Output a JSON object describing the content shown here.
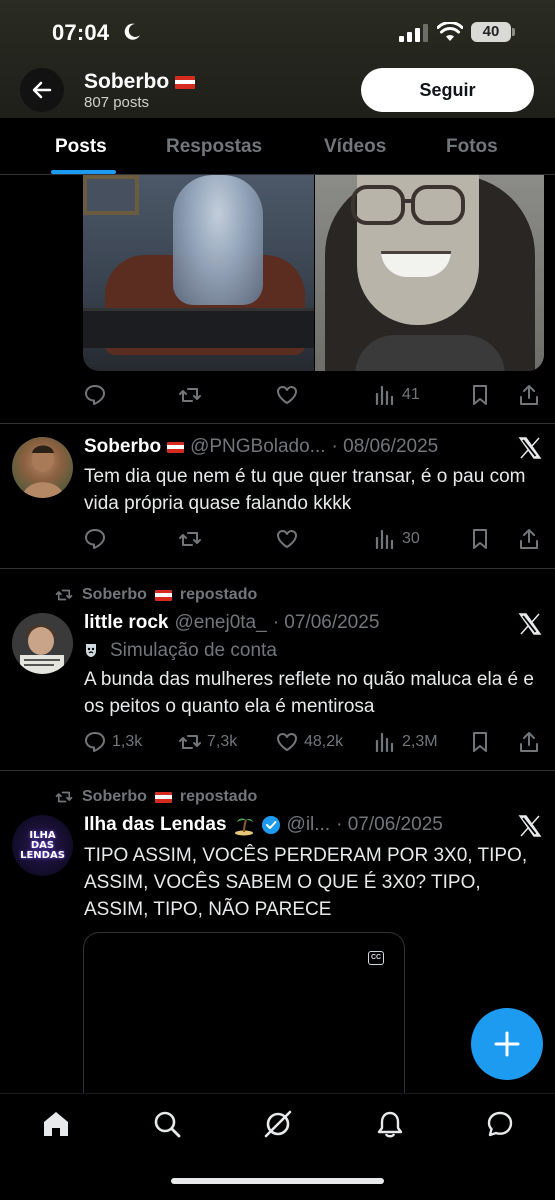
{
  "status_bar": {
    "time": "07:04",
    "battery": "40"
  },
  "header": {
    "profile_name": "Soberbo",
    "post_count": "807 posts",
    "follow_label": "Seguir"
  },
  "tabs": [
    {
      "label": "Posts",
      "active": true
    },
    {
      "label": "Respostas",
      "active": false
    },
    {
      "label": "Vídeos",
      "active": false
    },
    {
      "label": "Fotos",
      "active": false
    }
  ],
  "tweets": [
    {
      "actions": {
        "views": "41"
      }
    },
    {
      "name": "Soberbo",
      "handle": "@PNGBolado...",
      "date": "· 08/06/2025",
      "text": "Tem dia que nem é tu que quer transar, é o pau com vida própria quase falando kkkk",
      "actions": {
        "views": "30"
      }
    },
    {
      "repost_label": "Soberbo",
      "repost_suffix": "repostado",
      "name": "little rock",
      "handle": "@enej0ta_",
      "date": "· 07/06/2025",
      "simulation_label": "Simulação de conta",
      "text": "A bunda das mulheres reflete no quão maluca ela é e os peitos o quanto ela é mentirosa",
      "actions": {
        "replies": "1,3k",
        "reposts": "7,3k",
        "likes": "48,2k",
        "views": "2,3M"
      }
    },
    {
      "repost_label": "Soberbo",
      "repost_suffix": "repostado",
      "name": "Ilha das Lendas",
      "handle": "@il...",
      "date": "· 07/06/2025",
      "text": "TIPO ASSIM, VOCÊS PERDERAM POR 3X0, TIPO, ASSIM, VOCÊS SABEM O QUE É 3X0? TIPO, ASSIM, TIPO, NÃO PARECE",
      "avatar_text": "ILHA DAS LENDAS",
      "video_badge": "CC"
    }
  ],
  "colors": {
    "accent": "#1d9bf0",
    "background": "#000000",
    "muted": "#71767b"
  }
}
